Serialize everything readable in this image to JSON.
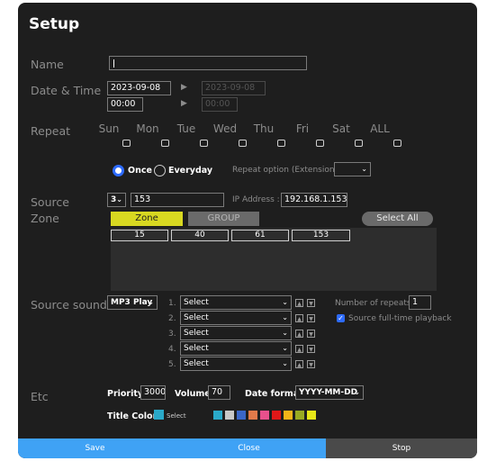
{
  "title": "Setup",
  "labels": {
    "name": "Name",
    "datetime": "Date & Time",
    "repeat": "Repeat",
    "source": "Source",
    "zone": "Zone",
    "source_sound": "Source sound",
    "etc": "Etc"
  },
  "datetime": {
    "start_date": "2023-09-08",
    "start_time": "00:00",
    "end_date": "2023-09-08",
    "end_time": "00:00",
    "arrow": "▶"
  },
  "repeat": {
    "days": [
      "Sun",
      "Mon",
      "Tue",
      "Wed",
      "Thu",
      "Fri",
      "Sat",
      "ALL"
    ],
    "once_label": "Once",
    "everyday_label": "Everyday",
    "option_label": "Repeat option (Extension)",
    "option_value": ""
  },
  "source": {
    "select_value": "3",
    "input_value": "153",
    "ip_label": "IP Address :",
    "ip_value": "192.168.1.153"
  },
  "zone": {
    "zone_tab": "Zone",
    "group_tab": "GROUP",
    "select_all": "Select All",
    "cells": [
      "15",
      "40",
      "61",
      "153"
    ]
  },
  "sound": {
    "type_value": "MP3 Play",
    "rows": [
      {
        "num": "1.",
        "value": "Select"
      },
      {
        "num": "2.",
        "value": "Select"
      },
      {
        "num": "3.",
        "value": "Select"
      },
      {
        "num": "4.",
        "value": "Select"
      },
      {
        "num": "5.",
        "value": "Select"
      }
    ],
    "repeats_label": "Number of repeats",
    "repeats_value": "1",
    "fulltime_label": "Source full-time playback"
  },
  "etc": {
    "priority_label": "Priority",
    "priority_value": "3000",
    "volume_label": "Volume",
    "volume_value": "70",
    "date_format_label": "Date format",
    "date_format_value": "YYYY-MM-DD",
    "title_color_label": "Title Color",
    "select_label": "Select",
    "selected_color": "#2aa9c9",
    "swatches": [
      "#2aa9c9",
      "#c8c8c8",
      "#3a66c8",
      "#e07a4a",
      "#e8508c",
      "#e01818",
      "#f2b418",
      "#99aa22",
      "#e8e818"
    ]
  },
  "footer": {
    "save": "Save",
    "close": "Close",
    "stop": "Stop",
    "save_color": "#3fa2f5",
    "close_color": "#3fa2f5",
    "stop_color": "#4a4a4a"
  }
}
